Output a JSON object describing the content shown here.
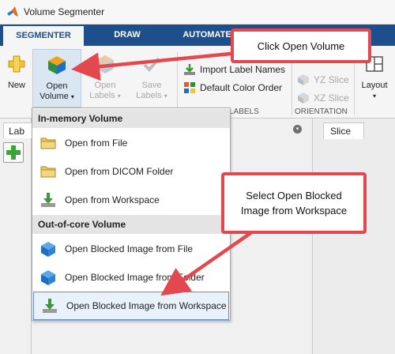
{
  "window": {
    "title": "Volume Segmenter"
  },
  "tabs": [
    {
      "label": "SEGMENTER",
      "active": true
    },
    {
      "label": "DRAW",
      "active": false
    },
    {
      "label": "AUTOMATE",
      "active": false
    }
  ],
  "toolstrip": {
    "new_label": "New",
    "open_volume_label": [
      "Open",
      "Volume"
    ],
    "open_labels_label": [
      "Open",
      "Labels"
    ],
    "save_labels_label": [
      "Save",
      "Labels"
    ],
    "import_label_names": "Import Label Names",
    "default_color_order": "Default Color Order",
    "labels_group": "LABELS",
    "yz_slice": "YZ Slice",
    "xz_slice": "XZ Slice",
    "orientation_group": "ORIENTATION",
    "layout_label": "Layout",
    "caret": "▾"
  },
  "panels": {
    "left_tab": "Lab",
    "slice_tab": "Slice"
  },
  "menu": {
    "section_in_memory": "In-memory Volume",
    "section_out_of_core": "Out-of-core Volume",
    "items": [
      {
        "label": "Open from File",
        "icon": "folder-icon"
      },
      {
        "label": "Open from DICOM Folder",
        "icon": "folder-icon"
      },
      {
        "label": "Open from Workspace",
        "icon": "workspace-import-icon"
      },
      {
        "label": "Open Blocked Image from File",
        "icon": "blocked-cube-icon"
      },
      {
        "label": "Open Blocked Image from Folder",
        "icon": "blocked-cube-icon"
      },
      {
        "label": "Open Blocked Image from Workspace",
        "icon": "workspace-import-icon",
        "highlighted": true
      }
    ]
  },
  "callouts": {
    "open_volume": "Click Open Volume",
    "blocked_workspace": "Select Open Blocked Image from Workspace"
  },
  "colors": {
    "tabbar": "#1c4f8c",
    "callout_border": "#e3484f",
    "menu_highlight": "#e9f1fb"
  }
}
